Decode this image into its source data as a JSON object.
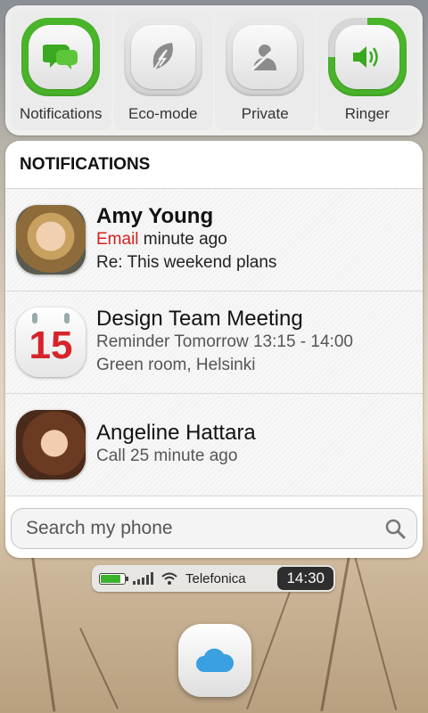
{
  "toggles": [
    {
      "label": "Notifications",
      "icon": "chat-bubbles-icon",
      "state": "on"
    },
    {
      "label": "Eco-mode",
      "icon": "leaf-icon",
      "state": "off"
    },
    {
      "label": "Private",
      "icon": "private-person-icon",
      "state": "off"
    },
    {
      "label": "Ringer",
      "icon": "speaker-icon",
      "state": "on"
    }
  ],
  "notifications": {
    "header": "NOTIFICATIONS",
    "items": [
      {
        "title": "Amy Young",
        "type": "Email",
        "time": "minute ago",
        "detail": "Re: This weekend plans"
      },
      {
        "title": "Design Team Meeting",
        "calendar_day": "15",
        "subtitle": "Reminder Tomorrow 13:15 - 14:00",
        "detail": "Green room, Helsinki"
      },
      {
        "title": "Angeline Hattara",
        "subtitle": "Call 25 minute ago"
      }
    ]
  },
  "search": {
    "placeholder": "Search my phone"
  },
  "statusbar": {
    "carrier": "Telefonica",
    "clock": "14:30",
    "battery_fraction": 0.8
  },
  "colors": {
    "accent_green": "#4ab52a",
    "email_red": "#d62020",
    "calendar_red": "#d6242b"
  }
}
